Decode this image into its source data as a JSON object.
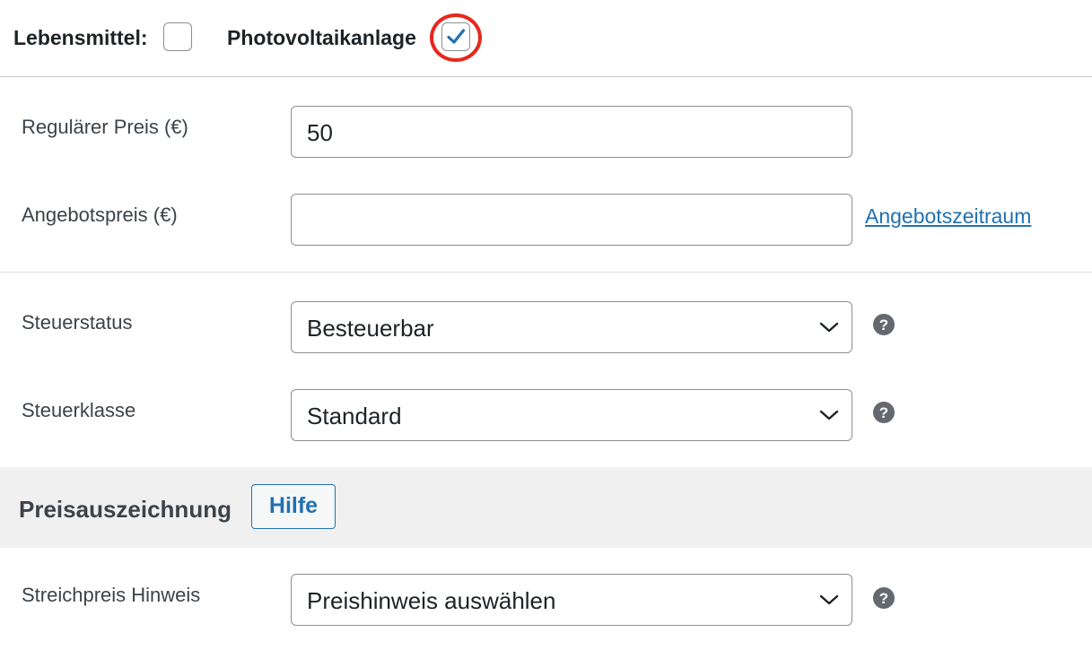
{
  "product_type": {
    "food_label": "Lebensmittel:",
    "food_checked": false,
    "pv_label": "Photovoltaikanlage",
    "pv_checked": true
  },
  "pricing": {
    "regular_price_label": "Regulärer Preis (€)",
    "regular_price_value": "50",
    "sale_price_label": "Angebotspreis (€)",
    "sale_price_value": "",
    "schedule_link": "Angebotszeitraum"
  },
  "tax": {
    "status_label": "Steuerstatus",
    "status_value": "Besteuerbar",
    "class_label": "Steuerklasse",
    "class_value": "Standard"
  },
  "price_labeling": {
    "title": "Preisauszeichnung",
    "help_button": "Hilfe",
    "strike_price_label": "Streichpreis Hinweis",
    "strike_price_value": "Preishinweis auswählen"
  },
  "colors": {
    "accent": "#2271b1",
    "highlight": "#e8271c",
    "section_bg": "#f0f0f1"
  }
}
